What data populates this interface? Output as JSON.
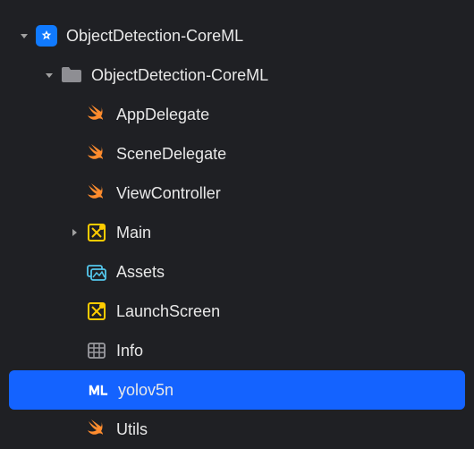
{
  "colors": {
    "background": "#1f2024",
    "selection": "#1463ff",
    "text": "#e8e8e8",
    "swift": "#ff8c2e",
    "folder": "#8e8e93",
    "project": "#107aff",
    "storyboard": "#ffcc00",
    "assets": "#54c7ec",
    "plist": "#8e8e93",
    "mlmodel": "#ffffff"
  },
  "tree": {
    "root": {
      "label": "ObjectDetection-CoreML",
      "expanded": true
    },
    "group": {
      "label": "ObjectDetection-CoreML",
      "expanded": true
    },
    "items": [
      {
        "label": "AppDelegate",
        "icon": "swift",
        "selected": false,
        "hasDisclosure": false
      },
      {
        "label": "SceneDelegate",
        "icon": "swift",
        "selected": false,
        "hasDisclosure": false
      },
      {
        "label": "ViewController",
        "icon": "swift",
        "selected": false,
        "hasDisclosure": false
      },
      {
        "label": "Main",
        "icon": "storyboard",
        "selected": false,
        "hasDisclosure": true,
        "expanded": false
      },
      {
        "label": "Assets",
        "icon": "assets",
        "selected": false,
        "hasDisclosure": false
      },
      {
        "label": "LaunchScreen",
        "icon": "storyboard",
        "selected": false,
        "hasDisclosure": false
      },
      {
        "label": "Info",
        "icon": "plist",
        "selected": false,
        "hasDisclosure": false
      },
      {
        "label": "yolov5n",
        "icon": "mlmodel",
        "selected": true,
        "hasDisclosure": false
      },
      {
        "label": "Utils",
        "icon": "swift",
        "selected": false,
        "hasDisclosure": false
      }
    ]
  }
}
